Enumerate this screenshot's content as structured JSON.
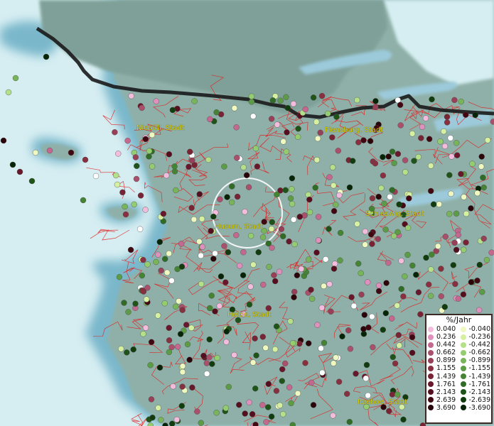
{
  "cities": [
    {
      "name": "Niebüll, Stadt"
    },
    {
      "name": "Flensburg, Stadt"
    },
    {
      "name": "Schleswig, Stadt"
    },
    {
      "name": "Husum, Stadt"
    },
    {
      "name": "Heide, Stadt"
    },
    {
      "name": "Itzehoe, Stadt"
    }
  ],
  "legend": {
    "title": "%/Jahr",
    "positive": [
      {
        "value": "0.040",
        "color": "#f4bcdc"
      },
      {
        "value": "0.236",
        "color": "#e090bc"
      },
      {
        "value": "0.442",
        "color": "#c46890"
      },
      {
        "value": "0.662",
        "color": "#a8506c"
      },
      {
        "value": "0.899",
        "color": "#984058"
      },
      {
        "value": "1.155",
        "color": "#883040"
      },
      {
        "value": "1.439",
        "color": "#782434"
      },
      {
        "value": "1.761",
        "color": "#68182a"
      },
      {
        "value": "2.143",
        "color": "#560e1e"
      },
      {
        "value": "2.639",
        "color": "#420812"
      },
      {
        "value": "3.690",
        "color": "#2a0408"
      }
    ],
    "negative": [
      {
        "value": "-0.040",
        "color": "#eef8c0"
      },
      {
        "value": "-0.236",
        "color": "#d4f0a0"
      },
      {
        "value": "-0.442",
        "color": "#b4e08a"
      },
      {
        "value": "-0.662",
        "color": "#94cc70"
      },
      {
        "value": "-0.899",
        "color": "#78b45a"
      },
      {
        "value": "-1.155",
        "color": "#5c9c46"
      },
      {
        "value": "-1.439",
        "color": "#448434"
      },
      {
        "value": "-1.761",
        "color": "#306c26"
      },
      {
        "value": "-2.143",
        "color": "#1e5418"
      },
      {
        "value": "-2.639",
        "color": "#103c0e"
      },
      {
        "value": "-3.690",
        "color": "#062406"
      }
    ]
  },
  "colors": {
    "sea": "#d6eef2",
    "coast_shadow": "#7ab8cc",
    "land": "#8fb0a8",
    "border_line": "#111111",
    "municipal_lines": "#e02020",
    "city_text": "#d8d000",
    "highlight_ring": "#ffffff",
    "no_change_dot": "#ffffff"
  }
}
